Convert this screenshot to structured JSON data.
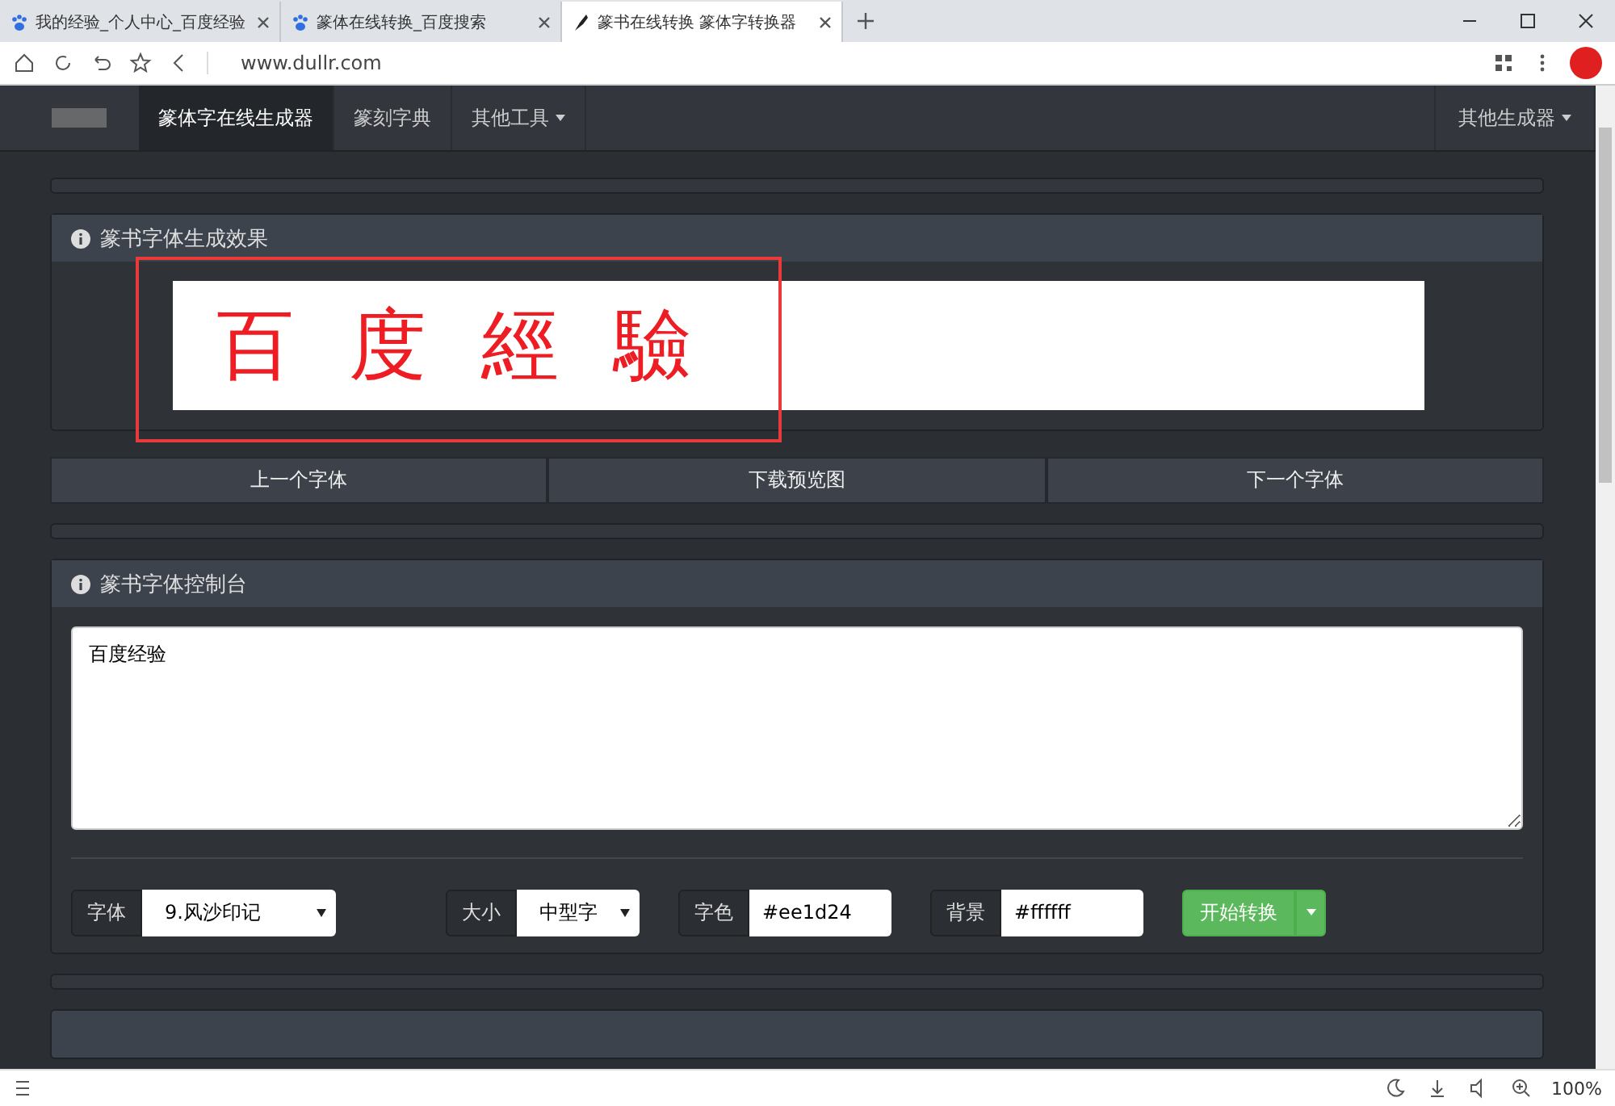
{
  "browser": {
    "tabs": [
      {
        "title": "我的经验_个人中心_百度经验",
        "selected": false
      },
      {
        "title": "篆体在线转换_百度搜索",
        "selected": false
      },
      {
        "title": "篆书在线转换 篆体字转换器",
        "selected": true
      }
    ],
    "url": "www.dullr.com",
    "zoom": "100%"
  },
  "navbar": {
    "items": [
      {
        "label": "篆体字在线生成器",
        "selected": true,
        "dropdown": false
      },
      {
        "label": "篆刻字典",
        "selected": false,
        "dropdown": false
      },
      {
        "label": "其他工具",
        "selected": false,
        "dropdown": true
      }
    ],
    "right_item": {
      "label": "其他生成器",
      "dropdown": true
    }
  },
  "preview_panel": {
    "title": "篆书字体生成效果",
    "preview_text": "百度經驗"
  },
  "preview_buttons": [
    "上一个字体",
    "下载预览图",
    "下一个字体"
  ],
  "control_panel": {
    "title": "篆书字体控制台",
    "text_value": "百度经验",
    "fields": [
      {
        "kind": "select",
        "label": "字体",
        "value": "9.风沙印记"
      },
      {
        "kind": "select",
        "label": "大小",
        "value": "中型字"
      },
      {
        "kind": "input",
        "label": "字色",
        "value": "#ee1d24"
      },
      {
        "kind": "input",
        "label": "背景",
        "value": "#ffffff"
      }
    ],
    "convert_button": "开始转换"
  }
}
